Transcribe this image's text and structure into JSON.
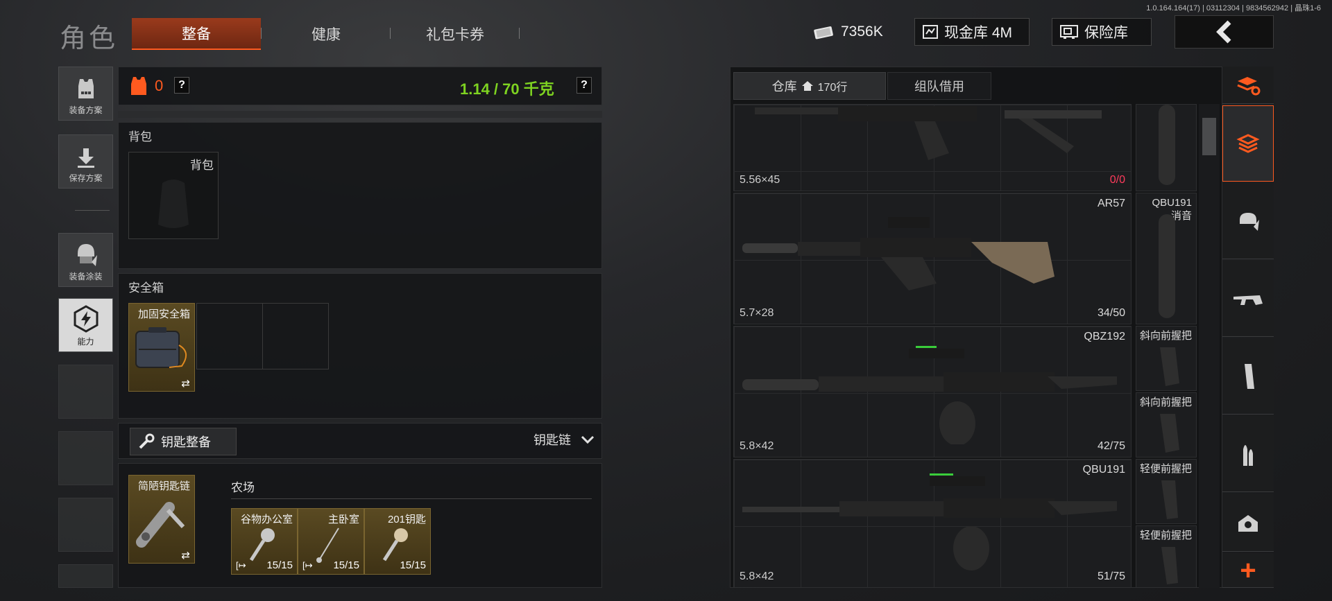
{
  "version_text": "1.0.164.164(17) | 03112304 | 9834562942 | 晶珠1-6",
  "header": {
    "title": "角色",
    "tabs": [
      {
        "label": "整备",
        "active": true
      },
      {
        "label": "健康",
        "active": false
      },
      {
        "label": "礼包卡券",
        "active": false
      }
    ],
    "currency": {
      "label": "7356K",
      "icon": "cash-icon"
    },
    "cash_vault": {
      "label": "现金库 4M",
      "icon": "vault-icon"
    },
    "safe_vault": {
      "label": "保险库",
      "icon": "safe-icon"
    }
  },
  "left_nav": [
    {
      "label": "装备方案",
      "icon": "vest-icon"
    },
    {
      "label": "保存方案",
      "icon": "download-icon"
    },
    {
      "label": "装备涂装",
      "icon": "helmet-icon"
    },
    {
      "label": "能力",
      "icon": "ability-icon",
      "active": true
    }
  ],
  "status": {
    "armor_count": "0",
    "help_1": "?",
    "weight": "1.14 / 70 千克",
    "help_2": "?"
  },
  "backpack": {
    "section_title": "背包",
    "slot_label": "背包"
  },
  "safe_box": {
    "section_title": "安全箱",
    "item_name": "加固安全箱",
    "swap": "⇄"
  },
  "keys": {
    "button_label": "钥匙整备",
    "chain_label": "钥匙链",
    "chain_item": "简陋钥匙链",
    "swap": "⇄",
    "location": "农场",
    "items": [
      {
        "name": "谷物办公室",
        "count": "15/15"
      },
      {
        "name": "主卧室",
        "count": "15/15"
      },
      {
        "name": "201钥匙",
        "count": "15/15"
      }
    ]
  },
  "warehouse": {
    "tab_storage": "仓库",
    "rows": "170行",
    "tab_team": "组队借用",
    "guns": [
      {
        "name": "",
        "caliber": "5.56×45",
        "ammo": "0/0",
        "ammo_color": "#ff3b5c"
      },
      {
        "name": "AR57",
        "caliber": "5.7×28",
        "ammo": "34/50",
        "ammo_color": "#dcdcdc"
      },
      {
        "name": "QBZ192",
        "caliber": "5.8×42",
        "ammo": "42/75",
        "ammo_color": "#dcdcdc"
      },
      {
        "name": "QBU191",
        "caliber": "5.8×42",
        "ammo": "51/75",
        "ammo_color": "#dcdcdc"
      }
    ],
    "side_items": [
      {
        "name": ""
      },
      {
        "name": "QBU191",
        "sub": "消音"
      },
      {
        "name": "斜向前握把"
      },
      {
        "name": "斜向前握把"
      },
      {
        "name": "轻便前握把"
      },
      {
        "name": "轻便前握把"
      }
    ]
  },
  "right_nav": [
    {
      "icon": "stack-refresh-icon"
    },
    {
      "icon": "stack-icon",
      "active": true
    },
    {
      "icon": "armor-icon"
    },
    {
      "icon": "rifle-icon"
    },
    {
      "icon": "magazine-icon"
    },
    {
      "icon": "ammo-icon"
    },
    {
      "icon": "sight-icon"
    },
    {
      "icon": "plus-icon",
      "label": "+"
    }
  ],
  "colors": {
    "accent": "#ff5a1f",
    "weight_green": "#7ed321",
    "gold": "#c9a44a"
  }
}
